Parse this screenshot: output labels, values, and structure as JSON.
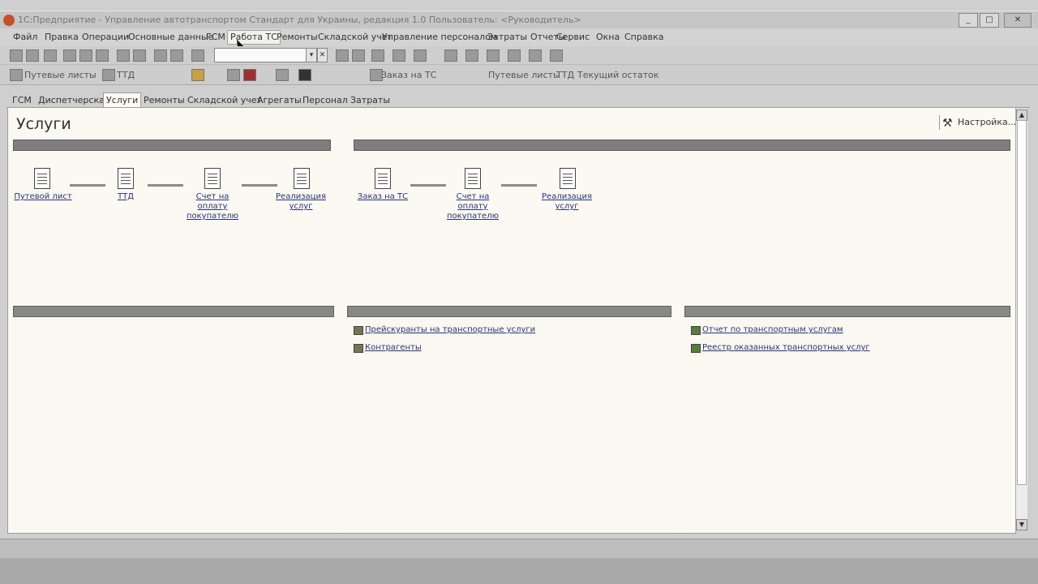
{
  "window": {
    "title": "1С:Предприятие - Управление автотранспортом Стандарт для Украины, редакция 1.0   Пользователь: <Руководитель>",
    "minimize": "_",
    "maximize": "□",
    "close": "✕"
  },
  "menu": {
    "items": [
      {
        "label": "Файл"
      },
      {
        "label": "Правка"
      },
      {
        "label": "Операции"
      },
      {
        "label": "Основные данные"
      },
      {
        "label": "ГСМ"
      },
      {
        "label": "Работа ТС"
      },
      {
        "label": "Ремонты"
      },
      {
        "label": "Складской учет"
      },
      {
        "label": "Управление персоналом"
      },
      {
        "label": "Затраты"
      },
      {
        "label": "Отчеты"
      },
      {
        "label": "Сервис"
      },
      {
        "label": "Окна"
      },
      {
        "label": "Справка"
      }
    ]
  },
  "toolbar2": {
    "items": [
      {
        "label": "Путевые листы"
      },
      {
        "label": "ТТД"
      },
      {
        "label": "Заказ на ТС"
      },
      {
        "label": "Путевые листы"
      },
      {
        "label": "ТТД"
      },
      {
        "label": "Текущий остаток"
      }
    ]
  },
  "tabs": [
    {
      "label": "ГСМ"
    },
    {
      "label": "Диспетчерская"
    },
    {
      "label": "Услуги",
      "active": true
    },
    {
      "label": "Ремонты"
    },
    {
      "label": "Складской учет"
    },
    {
      "label": "Агрегаты"
    },
    {
      "label": "Персонал"
    },
    {
      "label": "Затраты"
    }
  ],
  "page": {
    "title": "Услуги",
    "settings_label": "Настройка..."
  },
  "flow_left": {
    "docs": [
      {
        "label": "Путевой лист"
      },
      {
        "label": "ТТД"
      },
      {
        "label": "Счет на оплату покупателю"
      },
      {
        "label": "Реализация услуг"
      }
    ]
  },
  "flow_right": {
    "docs": [
      {
        "label": "Заказ на ТС"
      },
      {
        "label": "Счет на оплату покупателю"
      },
      {
        "label": "Реализация услуг"
      }
    ]
  },
  "panels": {
    "middle": {
      "links": [
        {
          "label": "Прейскуранты на транспортные услуги"
        },
        {
          "label": "Контрагенты"
        }
      ]
    },
    "right": {
      "links": [
        {
          "label": "Отчет по транспортным услугам"
        },
        {
          "label": "Реестр оказанных транспортных услуг"
        }
      ]
    }
  }
}
